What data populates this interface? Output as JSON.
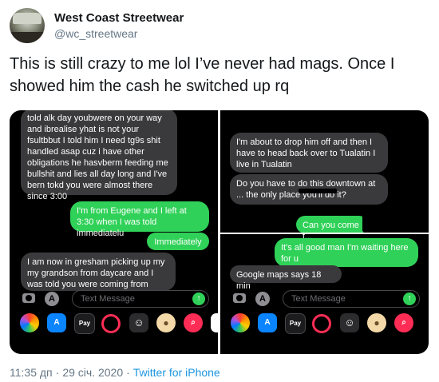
{
  "author": {
    "name": "West Coast Streetwear",
    "handle": "@wc_streetwear"
  },
  "tweet": {
    "text": "This is still crazy to me lol I’ve never had mags. Once I showed him the cash he switched up rq"
  },
  "left_screenshot": {
    "messages": [
      {
        "from": "them",
        "text": "told alk day youbwere on your way and ibrealise yhat is not your fsultbbut I told him I need tg9s shit handled asap cuz i have other obligations he hasvberm feeding me bullshit and lies all day long and I've bern tokd you were almost there since 3:00"
      },
      {
        "from": "me",
        "text": "I'm from Eugene and I left at 3:30 when I was told immediatelu"
      },
      {
        "from": "me",
        "text": "Immediately"
      },
      {
        "from": "them",
        "text": "I am now in gresham picking up my my grandson from daycare and I was told you were coming from"
      }
    ],
    "input_placeholder": "Text Message"
  },
  "right_screenshot": {
    "messages": [
      {
        "from": "them",
        "text": "I'm about to drop him off and then I have to head back over to Tualatin I live in Tualatin"
      },
      {
        "from": "them",
        "text": "Do you have to do this downtown at ... the only place you'll do it?"
      },
      {
        "from": "me",
        "text": "Can you come t..."
      },
      {
        "from": "me",
        "text": "It's all good man I'm waiting here for u"
      },
      {
        "from": "them",
        "text": "Google maps says 18 min"
      }
    ],
    "input_placeholder": "Text Message"
  },
  "app_tray": [
    "photos-app",
    "app-store",
    "apple-pay",
    "activity",
    "memoji",
    "animoji",
    "search-images",
    "music"
  ],
  "apple_pay_label": "Pay",
  "footer": {
    "time": "11:35 дп",
    "date": "29 січ. 2020",
    "source": "Twitter for iPhone"
  }
}
